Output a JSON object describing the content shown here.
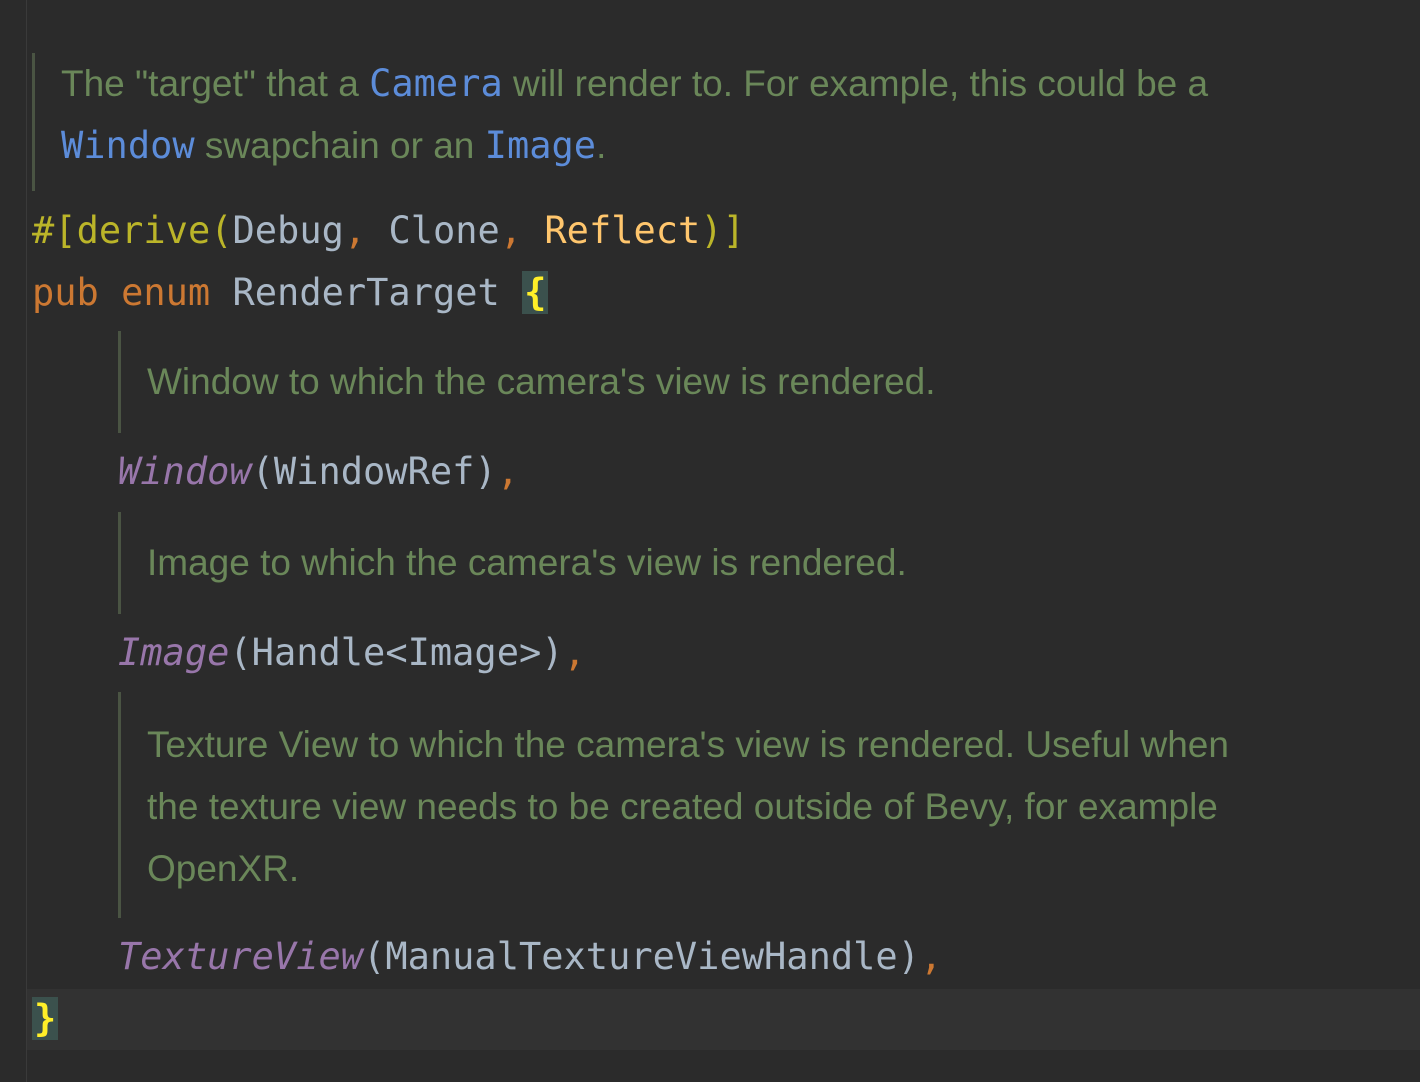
{
  "doc_top": {
    "line1": {
      "before": "The \"target\" that a ",
      "code1": "Camera",
      "after": " will render to. For example, this could be a"
    },
    "line2": {
      "code1": "Window",
      "mid": " swapchain or an ",
      "code2": "Image",
      "after": "."
    }
  },
  "attribute": {
    "hash_open": "#[",
    "derive": "derive",
    "paren_open": "(",
    "debug": "Debug",
    "comma1": ", ",
    "clone": "Clone",
    "comma2": ", ",
    "reflect": "Reflect",
    "close": ")]"
  },
  "enum_decl": {
    "pub": "pub",
    "enum": "enum",
    "name": "RenderTarget",
    "open_brace": "{"
  },
  "variants": [
    {
      "doc": [
        "Window to which the camera's view is rendered."
      ],
      "name": "Window",
      "args": "(WindowRef)",
      "comma": ","
    },
    {
      "doc": [
        "Image to which the camera's view is rendered."
      ],
      "name": "Image",
      "args": "(Handle<Image>)",
      "comma": ","
    },
    {
      "doc": [
        "Texture View to which the camera's view is rendered. Useful when",
        "the texture view needs to be created outside of Bevy, for example",
        "OpenXR."
      ],
      "name": "TextureView",
      "args": "(ManualTextureViewHandle)",
      "comma": ","
    }
  ],
  "close_brace": "}",
  "colors": {
    "background": "#2b2b2b",
    "doc_text": "#6a8759",
    "doc_code": "#5c8cd9",
    "keyword": "#cc7832",
    "attribute": "#bbb529",
    "reflect": "#ffc66d",
    "identifier": "#a9b7c6",
    "variant": "#9876aa",
    "brace": "#ffef28",
    "brace_highlight": "#3b514d"
  }
}
